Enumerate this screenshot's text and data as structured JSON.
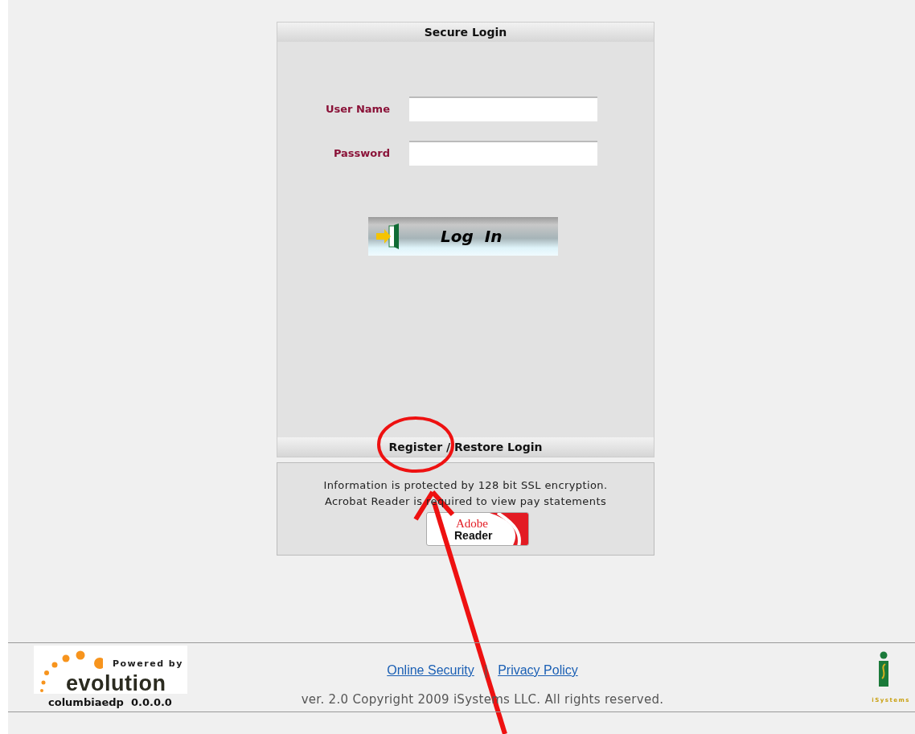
{
  "login_panel": {
    "title": "Secure Login",
    "fields": [
      {
        "label": "User Name"
      },
      {
        "label": "Password"
      }
    ],
    "login_button": "Log  In",
    "register_bar": "Register / Restore Login"
  },
  "info_box": {
    "lines": [
      "Information is protected by 128 bit SSL encryption.",
      "Acrobat Reader is required to view pay statements"
    ],
    "reader_badge": {
      "brand": "Adobe",
      "product": "Reader"
    }
  },
  "footer": {
    "logo": {
      "tagline": "Powered by",
      "name": "evolution"
    },
    "site_id": "columbiaedp  0.0.0.0",
    "links": [
      {
        "label": "Online Security"
      },
      {
        "label": "Privacy Policy"
      }
    ],
    "separator": "|",
    "copyright": "ver. 2.0 Copyright 2009 iSystems LLC. All rights reserved.",
    "partner_logo": "iSystems"
  },
  "annotations": {
    "circle": true,
    "arrow": true
  }
}
